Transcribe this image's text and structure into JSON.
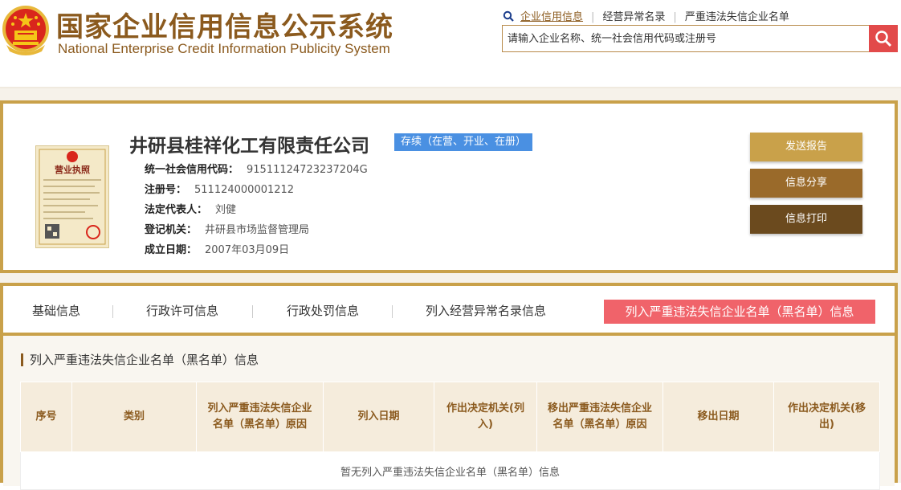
{
  "header": {
    "title_cn": "国家企业信用信息公示系统",
    "title_en": "National Enterprise Credit Information Publicity System",
    "nav": [
      "企业信用信息",
      "经营异常名录",
      "严重违法失信企业名单"
    ],
    "search_placeholder": "请输入企业名称、统一社会信用代码或注册号"
  },
  "company": {
    "name": "井研县桂祥化工有限责任公司",
    "status": "存续（在营、开业、在册）",
    "license_title": "营业执照",
    "fields": [
      {
        "key": "统一社会信用代码：",
        "value": "91511124723237204G"
      },
      {
        "key": "注册号：",
        "value": "511124000001212"
      },
      {
        "key": "法定代表人：",
        "value": "刘健"
      },
      {
        "key": "登记机关：",
        "value": "井研县市场监督管理局"
      },
      {
        "key": "成立日期：",
        "value": "2007年03月09日"
      }
    ],
    "actions": [
      "发送报告",
      "信息分享",
      "信息打印"
    ]
  },
  "tabs": [
    "基础信息",
    "行政许可信息",
    "行政处罚信息",
    "列入经营异常名录信息",
    "列入严重违法失信企业名单（黑名单）信息"
  ],
  "section": {
    "title": "列入严重违法失信企业名单（黑名单）信息",
    "columns": [
      "序号",
      "类别",
      "列入严重违法失信企业名单（黑名单）原因",
      "列入日期",
      "作出决定机关(列入)",
      "移出严重违法失信企业名单（黑名单）原因",
      "移出日期",
      "作出决定机关(移出)"
    ],
    "empty_text": "暂无列入严重违法失信企业名单（黑名单）信息"
  },
  "colors": {
    "brand": "#8b5a1e",
    "gold_border": "#c9a14a",
    "status_blue": "#4a90e2",
    "active_tab": "#f0636a",
    "search_btn": "#e24a4a",
    "btn_send": "#c9a14a",
    "btn_share": "#9a6a2a",
    "btn_print": "#6b4a1e"
  },
  "icons": [
    "national-emblem-icon",
    "search-icon",
    "business-license-icon"
  ]
}
